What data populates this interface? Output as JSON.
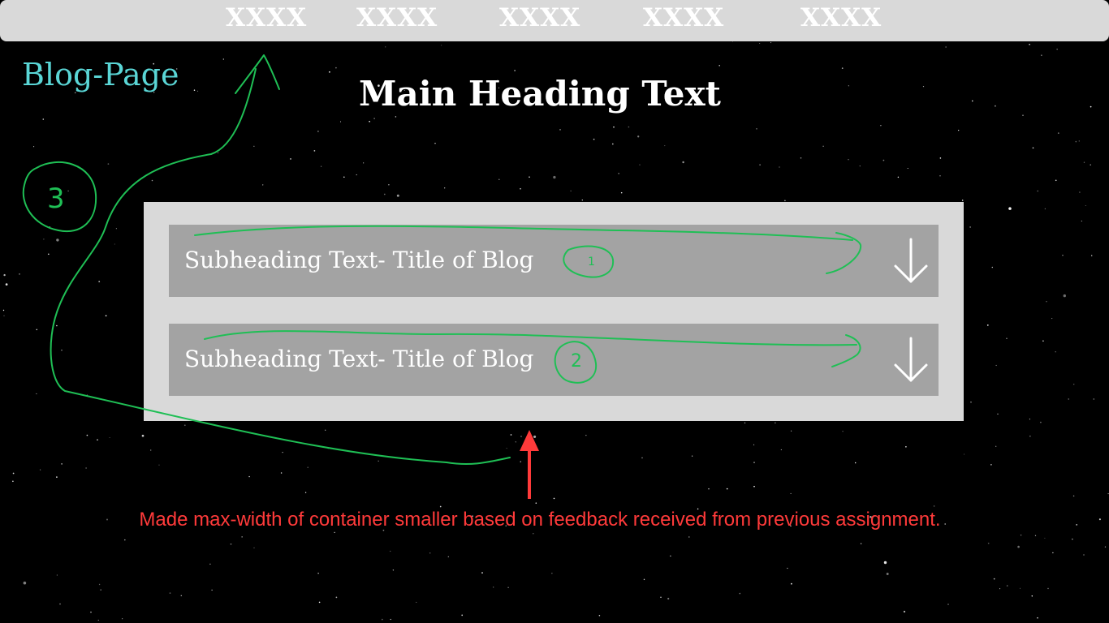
{
  "nav": {
    "links": [
      "XXXX",
      "XXXX",
      "XXXX",
      "XXXX",
      "XXXX"
    ]
  },
  "site_title": "Blog-Page",
  "main_heading": "Main Heading Text",
  "blog_rows": [
    {
      "title": "Subheading Text- Title of Blog",
      "icon": "arrow-down-icon"
    },
    {
      "title": "Subheading Text- Title of Blog",
      "icon": "arrow-down-icon"
    }
  ],
  "annotations": {
    "marker_1": "1",
    "marker_2": "2",
    "marker_3": "3",
    "note": "Made max-width of container smaller based on feedback received from previous assignment."
  },
  "colors": {
    "background": "#000000",
    "nav_bar": "#d9d9d9",
    "site_title": "#5ad6d6",
    "container": "#d9d9d9",
    "row": "#a3a3a3",
    "annotation_green": "#1fbf55",
    "note_red": "#ff3a3a"
  }
}
